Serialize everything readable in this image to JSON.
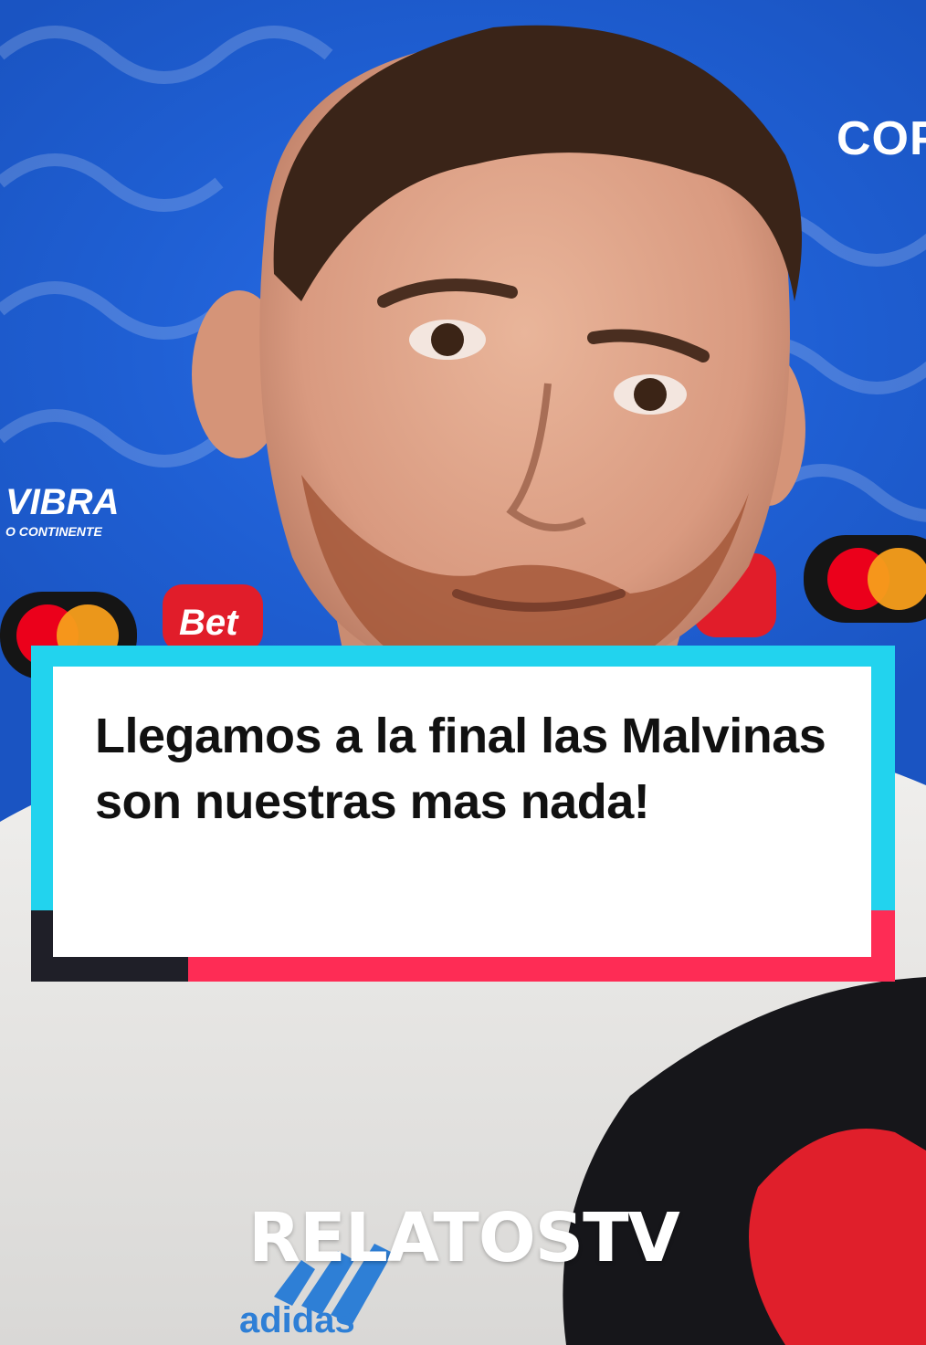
{
  "scene": {
    "backdrop_color": "#1f5fd3",
    "backdrop_texts": [
      "COP",
      "VIBRA",
      "O CONTINENTE",
      "Bet"
    ],
    "shirt_brand": "adidas"
  },
  "caption": {
    "text": "Llegamos a la final las Malvinas son nuestras mas nada!",
    "box_color": "#ffffff",
    "accent_cyan": "#22d3ee",
    "accent_pink": "#fe2c55"
  },
  "watermark": {
    "text": "RELATOSTV"
  }
}
